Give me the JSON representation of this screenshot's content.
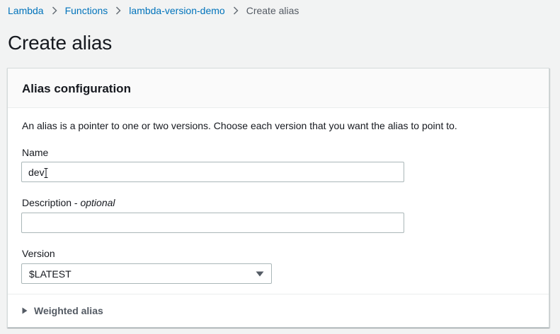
{
  "breadcrumb": {
    "items": [
      "Lambda",
      "Functions",
      "lambda-version-demo"
    ],
    "current": "Create alias"
  },
  "page": {
    "title": "Create alias"
  },
  "panel": {
    "title": "Alias configuration",
    "intro": "An alias is a pointer to one or two versions. Choose each version that you want the alias to point to.",
    "name": {
      "label": "Name",
      "value": "dev"
    },
    "description": {
      "label": "Description - ",
      "optional": "optional",
      "value": "",
      "placeholder": ""
    },
    "version": {
      "label": "Version",
      "selected": "$LATEST"
    },
    "weighted": {
      "label": "Weighted alias"
    }
  },
  "colors": {
    "link": "#0073bb",
    "background": "#f2f3f3",
    "border": "#aab7b8"
  }
}
